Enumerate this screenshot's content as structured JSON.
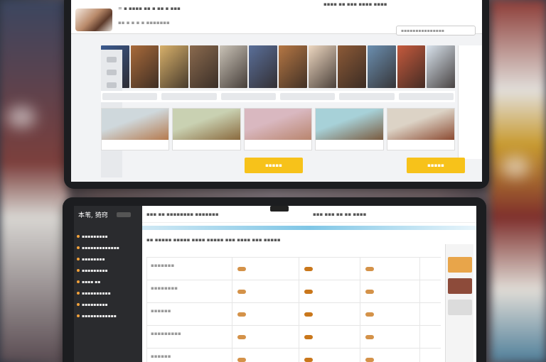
{
  "top_screen": {
    "header": {
      "nav": "= ▪ ▪▪▪▪ ▪▪ ▪ ▪▪  ▪ ▪▪▪",
      "subnav": "▪▪ ▪ ▪ ▪ ▪ ▪▪▪▪▪▪▪",
      "right": "▪▪▪▪ ▪▪  ▪▪▪  ▪▪▪▪  ▪▪▪▪",
      "search_placeholder": "▪▪▪▪▪▪▪▪▪▪▪▪▪▪▪"
    },
    "strip_colors": [
      "#3b5a8f",
      "#a86a3a",
      "#d7b06a",
      "#8a6a4e",
      "#c9c2b6",
      "#5a6f99",
      "#b57744",
      "#edd7c0",
      "#8c5a37",
      "#6b8fb0",
      "#c55a3d",
      "#d8e2ec"
    ],
    "cards": [
      {
        "color": "#cfd8dc",
        "accent": "#b57a4e"
      },
      {
        "color": "#c9d1b2",
        "accent": "#8a6a3e"
      },
      {
        "color": "#d9b8c0",
        "accent": "#b9856e"
      },
      {
        "color": "#a7d1d8",
        "accent": "#7a5a3e"
      },
      {
        "color": "#dcd3c6",
        "accent": "#8c4b32"
      }
    ],
    "cta_label": "▪▪▪▪▪"
  },
  "bottom_screen": {
    "sidebar": {
      "title": "本苇, 猗窍",
      "items": [
        "▪▪▪▪▪▪▪▪▪",
        "▪▪▪▪▪▪▪▪▪▪▪▪▪",
        "▪▪▪▪▪▪▪▪",
        "▪▪▪▪▪▪▪▪▪",
        "▪▪▪▪ ▪▪",
        "▪▪▪▪▪▪▪▪▪▪",
        "▪▪▪▪▪▪▪▪▪",
        "▪▪▪▪▪▪▪▪▪▪▪▪"
      ]
    },
    "header": {
      "nav": "▪▪▪ ▪▪  ▪▪▪▪▪▪▪▪ ▪▪▪▪▪▪▪",
      "right": "▪▪▪  ▪▪▪  ▪▪  ▪▪  ▪▪▪▪"
    },
    "filters": "▪▪ ▪▪▪▪▪  ▪▪▪▪▪  ▪▪▪▪  ▪▪▪▪▪  ▪▪▪  ▪▪▪▪  ▪▪▪ ▪▪▪▪▪",
    "table_rows": [
      "▪▪▪▪▪▪▪",
      "▪▪▪▪▪▪▪▪",
      "▪▪▪▪▪▪",
      "▪▪▪▪▪▪▪▪▪",
      "▪▪▪▪▪▪"
    ]
  }
}
